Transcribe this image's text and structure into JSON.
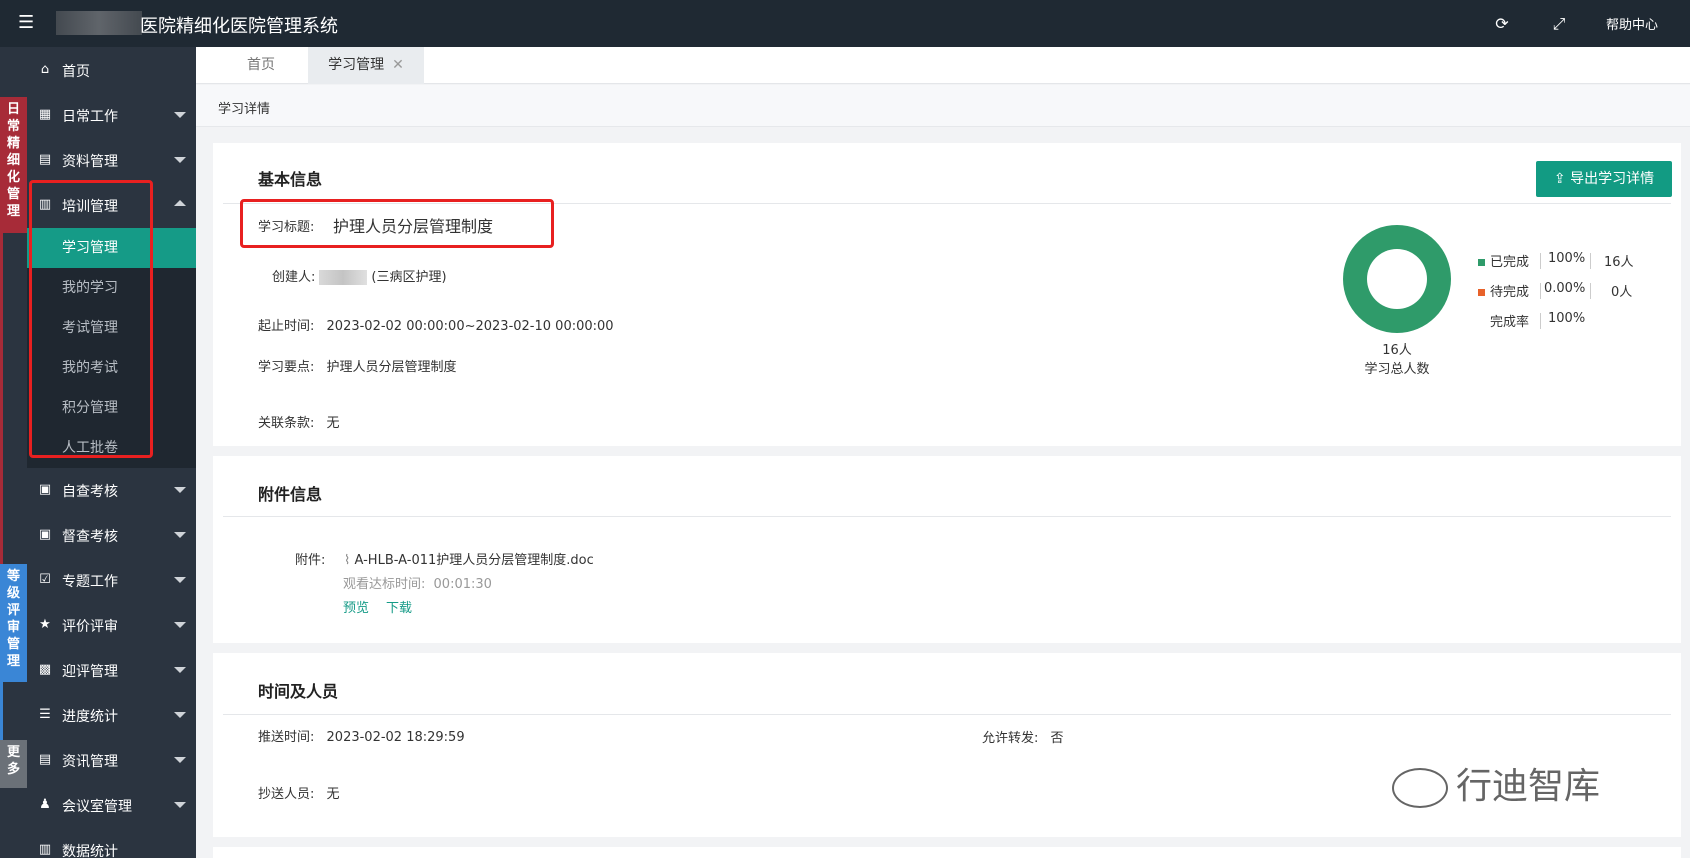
{
  "header": {
    "title": "医院精细化医院管理系统",
    "help": "帮助中心"
  },
  "categories": {
    "daily": "日常精细化管理",
    "grade": "等级评审管理",
    "more": "更多"
  },
  "sidebar": {
    "items": [
      {
        "label": "首页",
        "icon": "home-icon"
      },
      {
        "label": "日常工作",
        "icon": "calendar-icon"
      },
      {
        "label": "资料管理",
        "icon": "folder-icon"
      },
      {
        "label": "培训管理",
        "icon": "book-icon"
      },
      {
        "label": "自查考核",
        "icon": "clipboard-icon"
      },
      {
        "label": "督查考核",
        "icon": "clipboard-check-icon"
      },
      {
        "label": "专题工作",
        "icon": "task-icon"
      },
      {
        "label": "评价评审",
        "icon": "star-icon"
      },
      {
        "label": "迎评管理",
        "icon": "save-icon"
      },
      {
        "label": "进度统计",
        "icon": "bars-icon"
      },
      {
        "label": "资讯管理",
        "icon": "news-icon"
      },
      {
        "label": "会议室管理",
        "icon": "people-icon"
      },
      {
        "label": "数据统计",
        "icon": "chart-icon"
      }
    ],
    "sub_items": [
      "学习管理",
      "我的学习",
      "考试管理",
      "我的考试",
      "积分管理",
      "人工批卷"
    ]
  },
  "tabs": [
    {
      "label": "首页"
    },
    {
      "label": "学习管理"
    }
  ],
  "breadcrumb": "学习详情",
  "basic": {
    "title": "基本信息",
    "export_label": "导出学习详情",
    "study_title_key": "学习标题:",
    "study_title_val": "护理人员分层管理制度",
    "creator_key": "创建人:",
    "creator_dept": "(三病区护理)",
    "period_key": "起止时间:",
    "period_val": "2023-02-02 00:00:00~2023-02-10 00:00:00",
    "points_key": "学习要点:",
    "points_val": "护理人员分层管理制度",
    "clause_key": "关联条款:",
    "clause_val": "无"
  },
  "stats": {
    "total_count": "16人",
    "total_label": "学习总人数",
    "completed": {
      "label": "已完成",
      "percent": "100%",
      "count": "16人",
      "color": "#2f9b6a"
    },
    "pending": {
      "label": "待完成",
      "percent": "0.00%",
      "count": "0人",
      "color": "#e8622a"
    },
    "rate": {
      "label": "完成率",
      "value": "100%"
    }
  },
  "attachment": {
    "title": "附件信息",
    "key": "附件:",
    "file": "A-HLB-A-011护理人员分层管理制度.doc",
    "watch_label": "观看达标时间:",
    "watch_time": "00:01:30",
    "preview": "预览",
    "download": "下载"
  },
  "people": {
    "title": "时间及人员",
    "push_key": "推送时间:",
    "push_val": "2023-02-02 18:29:59",
    "forward_key": "允许转发:",
    "forward_val": "否",
    "cc_key": "抄送人员:",
    "cc_val": "无"
  },
  "watermark": "行迪智库"
}
